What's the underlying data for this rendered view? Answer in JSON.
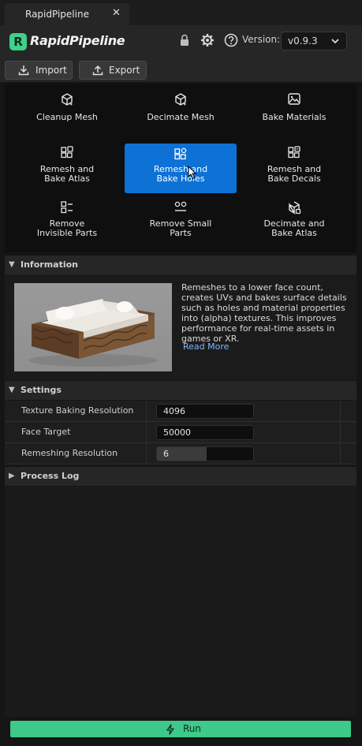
{
  "tab": {
    "title": "RapidPipeline",
    "close": "✕"
  },
  "header": {
    "logo_mark": "R",
    "logo_text": "RapidPipeline",
    "version_label": "Version:",
    "version_value": "v0.9.3",
    "icons": [
      "lock-icon",
      "gear-icon",
      "help-icon",
      "chevron-down-icon"
    ]
  },
  "toolbar": {
    "import_label": "Import",
    "export_label": "Export"
  },
  "tools": [
    {
      "line1": "Cleanup Mesh",
      "line2": "",
      "icon": "cube-spark-icon"
    },
    {
      "line1": "Decimate Mesh",
      "line2": "",
      "icon": "cube-spark-icon"
    },
    {
      "line1": "Bake Materials",
      "line2": "",
      "icon": "image-spark-icon"
    },
    {
      "line1": "Remesh and",
      "line2": "Bake Atlas",
      "icon": "grid-atlas-icon"
    },
    {
      "line1": "Remesh and",
      "line2": "Bake Holes",
      "icon": "grid-holes-icon"
    },
    {
      "line1": "Remesh and",
      "line2": "Bake Decals",
      "icon": "grid-decals-icon"
    },
    {
      "line1": "Remove",
      "line2": "Invisible Parts",
      "icon": "remove-parts-icon"
    },
    {
      "line1": "Remove Small",
      "line2": "Parts",
      "icon": "remove-small-icon"
    },
    {
      "line1": "Decimate and",
      "line2": "Bake Atlas",
      "icon": "cube-atlas-icon"
    }
  ],
  "information": {
    "title": "Information",
    "description": "Remeshes to a lower face count, creates UVs and bakes surface details such as holes and material properties into (alpha) textures. This improves performance for real-time assets in games or XR.",
    "read_more": "Read More"
  },
  "settings": {
    "title": "Settings",
    "rows": [
      {
        "label": "Texture Baking Resolution",
        "value": "4096"
      },
      {
        "label": "Face Target",
        "value": "50000"
      },
      {
        "label": "Remeshing Resolution",
        "value": "6",
        "level": 0.52
      }
    ]
  },
  "process_log": {
    "title": "Process Log"
  },
  "run": {
    "label": "Run"
  },
  "colors": {
    "accent_blue": "#0d71d6",
    "run_green": "#3cc98a",
    "link_blue": "#7fb4ff"
  }
}
